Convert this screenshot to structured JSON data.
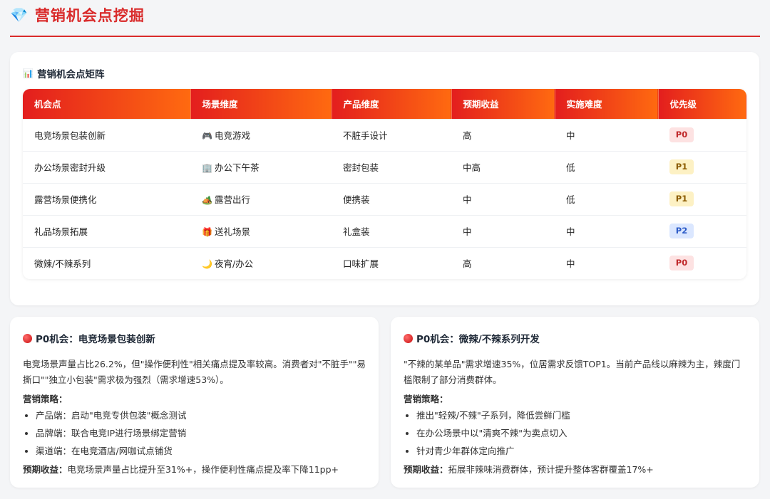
{
  "header": {
    "icon": "diamond-icon",
    "title": "营销机会点挖掘"
  },
  "matrix": {
    "icon": "bar-chart-icon",
    "title": "营销机会点矩阵",
    "columns": [
      "机会点",
      "场景维度",
      "产品维度",
      "预期收益",
      "实施难度",
      "优先级"
    ],
    "rows": [
      {
        "opportunity": "电竞场景包装创新",
        "scene_icon": "🎮",
        "scene": "电竞游戏",
        "product": "不脏手设计",
        "benefit": "高",
        "difficulty": "中",
        "priority": "P0"
      },
      {
        "opportunity": "办公场景密封升级",
        "scene_icon": "🏢",
        "scene": "办公下午茶",
        "product": "密封包装",
        "benefit": "中高",
        "difficulty": "低",
        "priority": "P1"
      },
      {
        "opportunity": "露营场景便携化",
        "scene_icon": "🏕️",
        "scene": "露营出行",
        "product": "便携装",
        "benefit": "中",
        "difficulty": "低",
        "priority": "P1"
      },
      {
        "opportunity": "礼品场景拓展",
        "scene_icon": "🎁",
        "scene": "送礼场景",
        "product": "礼盒装",
        "benefit": "中",
        "difficulty": "中",
        "priority": "P2"
      },
      {
        "opportunity": "微辣/不辣系列",
        "scene_icon": "🌙",
        "scene": "夜宵/办公",
        "product": "口味扩展",
        "benefit": "高",
        "difficulty": "中",
        "priority": "P0"
      }
    ],
    "priority_colors": {
      "P0": "#c0282a",
      "P1": "#8a5a00",
      "P2": "#2c5bc7"
    }
  },
  "opportunities": [
    {
      "title": "P0机会：电竞场景包装创新",
      "description": "电竞场景声量占比26.2%，但\"操作便利性\"相关痛点提及率较高。消费者对\"不脏手\"\"易撕口\"\"独立小包装\"需求极为强烈（需求增速53%）。",
      "strategy_label": "营销策略：",
      "strategies": [
        "产品端：启动\"电竞专供包装\"概念测试",
        "品牌端：联合电竞IP进行场景绑定营销",
        "渠道端：在电竞酒店/网咖试点铺货"
      ],
      "benefit_label": "预期收益：",
      "benefit_text": "电竞场景声量占比提升至31%+，操作便利性痛点提及率下降11pp+"
    },
    {
      "title": "P0机会：微辣/不辣系列开发",
      "description": "\"不辣的某单品\"需求增速35%，位居需求反馈TOP1。当前产品线以麻辣为主，辣度门槛限制了部分消费群体。",
      "strategy_label": "营销策略：",
      "strategies": [
        "推出\"轻辣/不辣\"子系列，降低尝鲜门槛",
        "在办公场景中以\"清爽不辣\"为卖点切入",
        "针对青少年群体定向推广"
      ],
      "benefit_label": "预期收益：",
      "benefit_text": "拓展非辣味消费群体，预计提升整体客群覆盖17%+"
    }
  ]
}
